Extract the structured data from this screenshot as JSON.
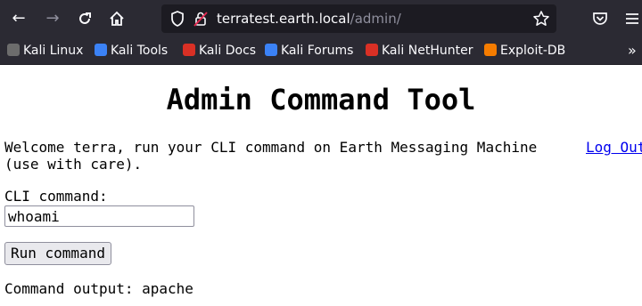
{
  "browser": {
    "back_icon": "back-arrow-icon",
    "forward_icon": "forward-arrow-icon",
    "reload_icon": "reload-icon",
    "home_icon": "home-icon",
    "url_host": "terratest.earth.local",
    "url_path": "/admin/",
    "bookmarks": [
      {
        "label": "Kali Linux",
        "color": "#6c6c6c"
      },
      {
        "label": "Kali Tools",
        "color": "#3b82f6"
      },
      {
        "label": "Kali Docs",
        "color": "#d93025"
      },
      {
        "label": "Kali Forums",
        "color": "#3b82f6"
      },
      {
        "label": "Kali NetHunter",
        "color": "#d93025"
      },
      {
        "label": "Exploit-DB",
        "color": "#f57c00"
      }
    ],
    "overflow_label": "»"
  },
  "page": {
    "title": "Admin Command Tool",
    "welcome_line1": "Welcome terra, run your CLI command on Earth Messaging Machine",
    "welcome_line2": "(use with care).",
    "logout_label": "Log Out",
    "cli_label": "CLI command:",
    "cli_value": "whoami",
    "run_button": "Run command",
    "output_label": "Command output: apache"
  }
}
